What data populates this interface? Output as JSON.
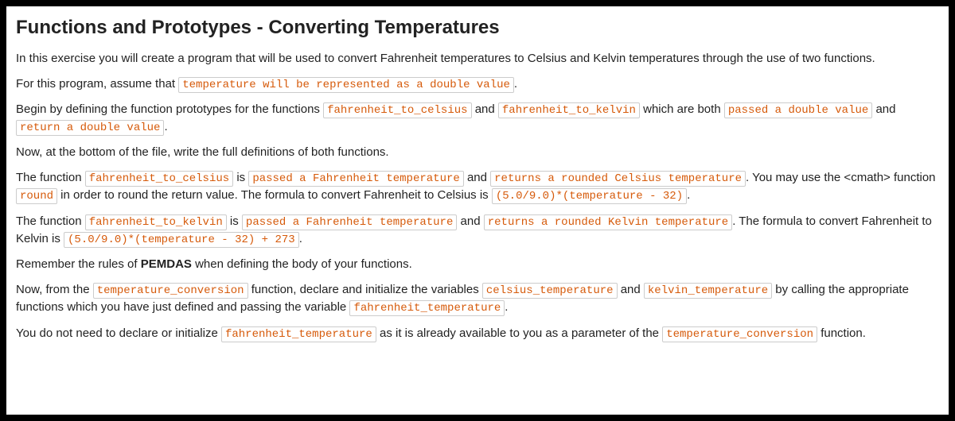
{
  "title": "Functions and Prototypes - Converting Temperatures",
  "p1_a": "In this exercise you will create a program that will be used to convert Fahrenheit temperatures to Celsius and Kelvin temperatures through the use of two functions.",
  "p2_a": "For this program, assume that ",
  "p2_code1": "temperature will be represented as a double value",
  "p2_b": ".",
  "p3_a": "Begin by defining the function prototypes for the functions ",
  "p3_code1": "fahrenheit_to_celsius",
  "p3_b": " and ",
  "p3_code2": "fahrenheit_to_kelvin",
  "p3_c": " which are both ",
  "p3_code3": "passed a double value",
  "p3_d": " and ",
  "p3_code4": "return a double value",
  "p3_e": ".",
  "p4_a": "Now, at the bottom of the file, write the full definitions of both functions.",
  "p5_a": "The function ",
  "p5_code1": "fahrenheit_to_celsius",
  "p5_b": " is ",
  "p5_code2": "passed a Fahrenheit temperature",
  "p5_c": " and ",
  "p5_code3": "returns a rounded Celsius temperature",
  "p5_d": ". You may use the <cmath> function ",
  "p5_code4": "round",
  "p5_e": " in order to round the return value. The formula to convert Fahrenheit to Celsius is ",
  "p5_code5": "(5.0/9.0)*(temperature - 32)",
  "p5_f": ".",
  "p6_a": "The function ",
  "p6_code1": "fahrenheit_to_kelvin",
  "p6_b": " is ",
  "p6_code2": "passed a Fahrenheit temperature",
  "p6_c": " and ",
  "p6_code3": "returns a rounded Kelvin temperature",
  "p6_d": ". The formula to convert Fahrenheit to Kelvin is ",
  "p6_code4": "(5.0/9.0)*(temperature - 32) + 273",
  "p6_e": ".",
  "p7_a": "Remember the rules of ",
  "p7_bold": "PEMDAS",
  "p7_b": " when defining the body of your functions.",
  "p8_a": "Now, from the ",
  "p8_code1": "temperature_conversion",
  "p8_b": " function, declare and initialize the variables ",
  "p8_code2": "celsius_temperature",
  "p8_c": " and ",
  "p8_code3": "kelvin_temperature",
  "p8_d": " by calling the appropriate functions which you have just defined and passing the variable ",
  "p8_code4": "fahrenheit_temperature",
  "p8_e": ".",
  "p9_a": "You do not need to declare or initialize ",
  "p9_code1": "fahrenheit_temperature",
  "p9_b": " as it is already available to you as a parameter of the ",
  "p9_code2": "temperature_conversion",
  "p9_c": " function."
}
